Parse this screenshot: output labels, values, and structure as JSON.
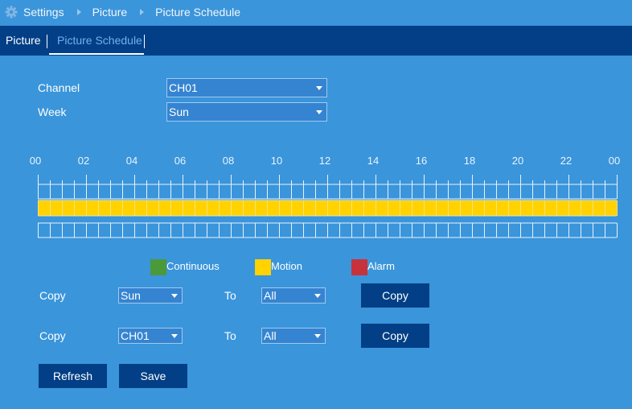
{
  "breadcrumb": {
    "icon": "gear-icon",
    "items": [
      "Settings",
      "Picture",
      "Picture Schedule"
    ]
  },
  "tabs": [
    {
      "label": "Picture",
      "active": false
    },
    {
      "label": "Picture Schedule",
      "active": true
    }
  ],
  "form": {
    "channel_label": "Channel",
    "channel_value": "CH01",
    "week_label": "Week",
    "week_value": "Sun"
  },
  "schedule": {
    "hour_labels": [
      "00",
      "02",
      "04",
      "06",
      "08",
      "10",
      "12",
      "14",
      "16",
      "18",
      "20",
      "22",
      "00"
    ],
    "slot_minutes": 30,
    "slots_per_day": 48,
    "rows": [
      {
        "type": "Continuous",
        "active_slots": "none"
      },
      {
        "type": "Motion",
        "active_slots": "all"
      },
      {
        "type": "Alarm",
        "active_slots": "none"
      }
    ]
  },
  "legend": [
    {
      "label": "Continuous",
      "color": "#4a9a3a"
    },
    {
      "label": "Motion",
      "color": "#ffd200"
    },
    {
      "label": "Alarm",
      "color": "#c8323a"
    }
  ],
  "copy_rows": [
    {
      "label": "Copy",
      "from_value": "Sun",
      "to_label": "To",
      "to_value": "All",
      "button": "Copy"
    },
    {
      "label": "Copy",
      "from_value": "CH01",
      "to_label": "To",
      "to_value": "All",
      "button": "Copy"
    }
  ],
  "actions": {
    "refresh": "Refresh",
    "save": "Save"
  },
  "colors": {
    "background": "#3a95db",
    "tabbar": "#023f86",
    "button": "#023f86",
    "motion": "#ffd200",
    "grid_line": "#e8f2fb"
  }
}
